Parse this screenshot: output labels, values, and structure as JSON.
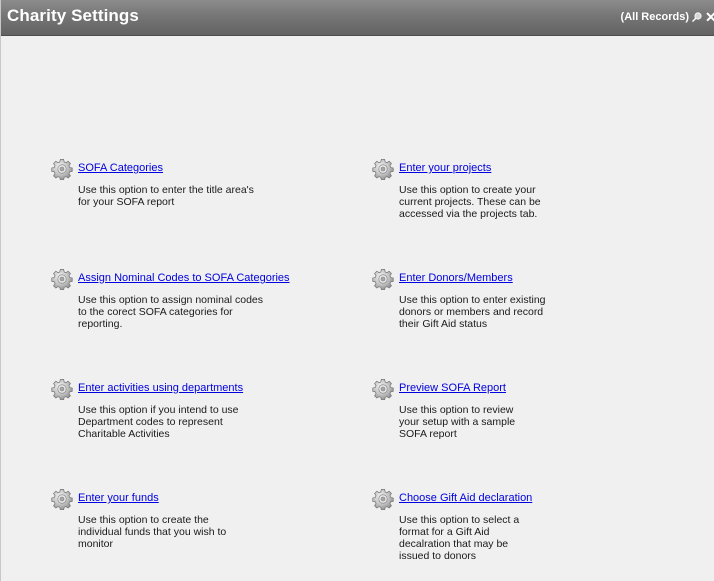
{
  "window": {
    "title": "Charity Settings",
    "records_label": "(All Records)",
    "close_glyph": "✕"
  },
  "icons": {
    "gear": "gear-icon",
    "pin": "pin-icon",
    "close": "close-icon"
  },
  "colors": {
    "titlebar": "#767676",
    "link": "#0000e0",
    "background": "#f0f0f0"
  },
  "options": [
    {
      "link": "SOFA Categories",
      "description": "Use this option to enter the title area's\nfor your SOFA report"
    },
    {
      "link": "Enter your projects",
      "description": "Use this option to create your\ncurrent projects. These can be\naccessed via the projects tab."
    },
    {
      "link": "Assign Nominal Codes to SOFA Categories",
      "description": "Use this option to assign nominal codes\nto the corect SOFA categories for\nreporting."
    },
    {
      "link": "Enter Donors/Members",
      "description": "Use this option to enter existing\ndonors or members and record\ntheir Gift Aid status"
    },
    {
      "link": "Enter activities using departments",
      "description": "Use this option if you intend to use\nDepartment codes to represent\nCharitable Activities"
    },
    {
      "link": "Preview SOFA Report",
      "description": "Use this option to review\nyour setup with a sample\nSOFA report"
    },
    {
      "link": "Enter your funds",
      "description": "Use this option to create the\nindividual funds that you wish to\nmonitor"
    },
    {
      "link": "Choose Gift Aid declaration",
      "description": "Use this option to select a\nformat for a Gift Aid\ndecalration that may be\nissued to donors"
    }
  ]
}
